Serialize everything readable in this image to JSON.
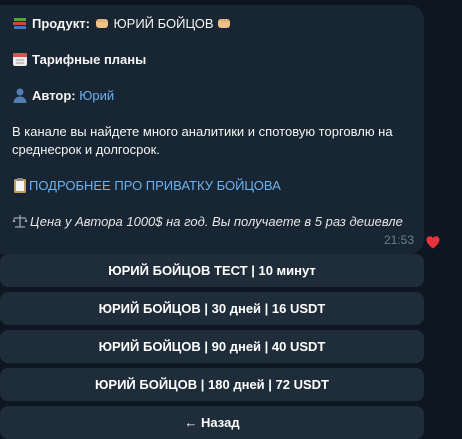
{
  "message": {
    "product_label": "Продукт:",
    "product_name": "ЮРИЙ БОЙЦОВ",
    "plans_title": "Тарифные планы",
    "author_label": "Автор:",
    "author_name": "Юрий",
    "description_1": "В канале вы найдете много аналитики и спотовую торговлю на",
    "description_2": "среднесрок и долгосрок.",
    "more_link": "ПОДРОБНЕЕ ПРО ПРИВАТКУ БОЙЦОВА",
    "price_note": "Цена у Автора 1000$ на год. Вы получаете в 5 раз дешевле",
    "time": "21:53"
  },
  "buttons": [
    {
      "label": "ЮРИЙ БОЙЦОВ ТЕСТ | 10 минут"
    },
    {
      "label": "ЮРИЙ БОЙЦОВ | 30 дней | 16 USDT"
    },
    {
      "label": "ЮРИЙ БОЙЦОВ | 90 дней | 40 USDT"
    },
    {
      "label": "ЮРИЙ БОЙЦОВ | 180 дней | 72 USDT"
    },
    {
      "label": "← Назад"
    }
  ],
  "icons": {
    "books": "books-icon",
    "fist": "fist-icon",
    "calendar": "calendar-icon",
    "person": "person-icon",
    "clipboard": "clipboard-icon",
    "scales": "scales-icon",
    "heart": "heart-icon"
  },
  "colors": {
    "background": "#0e1621",
    "bubble": "#182533",
    "link": "#6ab3f3",
    "button": "#1f2d3b",
    "reaction": "#e8333a"
  }
}
